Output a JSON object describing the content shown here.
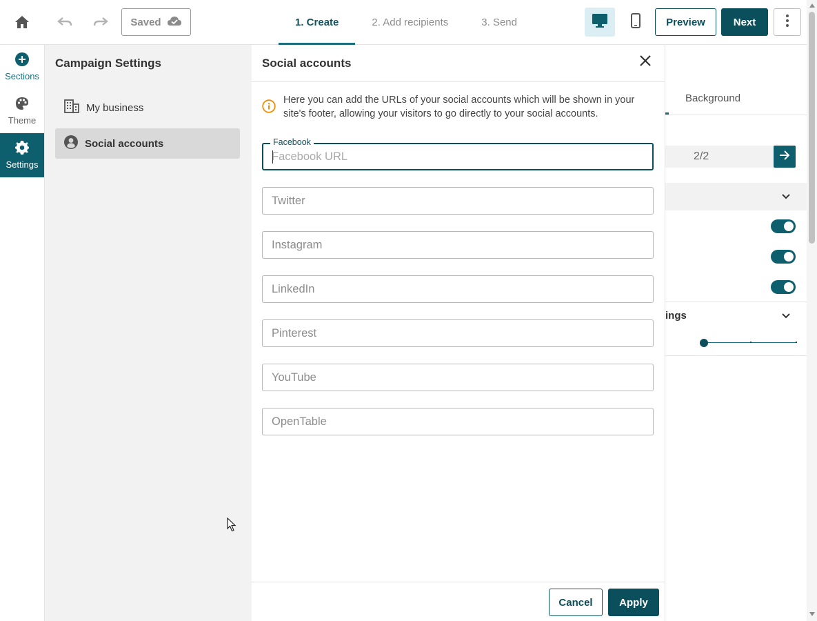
{
  "topbar": {
    "saved_label": "Saved",
    "steps": [
      {
        "label": "1. Create",
        "active": true
      },
      {
        "label": "2. Add recipients",
        "active": false
      },
      {
        "label": "3. Send",
        "active": false
      }
    ],
    "preview_label": "Preview",
    "next_label": "Next"
  },
  "rail": {
    "items": [
      {
        "label": "Sections",
        "icon": "plus-circle-icon"
      },
      {
        "label": "Theme",
        "icon": "palette-icon"
      },
      {
        "label": "Settings",
        "icon": "gear-icon",
        "active": true
      }
    ]
  },
  "settings_panel": {
    "title": "Campaign Settings",
    "items": [
      {
        "label": "My business",
        "icon": "building-icon"
      },
      {
        "label": "Social accounts",
        "icon": "user-circle-icon",
        "active": true
      }
    ]
  },
  "modal": {
    "title": "Social accounts",
    "info": "Here you can add the URLs of your social accounts which will be shown in your site's footer, allowing your visitors to go directly to your social accounts.",
    "fields": [
      {
        "label": "Facebook",
        "placeholder": "Facebook URL",
        "value": "",
        "focused": true
      },
      {
        "label": "",
        "placeholder": "Twitter",
        "value": ""
      },
      {
        "label": "",
        "placeholder": "Instagram",
        "value": ""
      },
      {
        "label": "",
        "placeholder": "LinkedIn",
        "value": ""
      },
      {
        "label": "",
        "placeholder": "Pinterest",
        "value": ""
      },
      {
        "label": "",
        "placeholder": "YouTube",
        "value": ""
      },
      {
        "label": "",
        "placeholder": "OpenTable",
        "value": ""
      }
    ],
    "cancel_label": "Cancel",
    "apply_label": "Apply"
  },
  "right_panel": {
    "tab_label": "Background",
    "pager_text": "2/2",
    "accordion_label": "ings",
    "toggles_on": [
      true,
      true,
      true
    ]
  },
  "colors": {
    "primary": "#0b4f5c",
    "rail_active": "#0e5f6d",
    "info_icon": "#f08c00",
    "panel_bg": "#f2f2f2"
  }
}
